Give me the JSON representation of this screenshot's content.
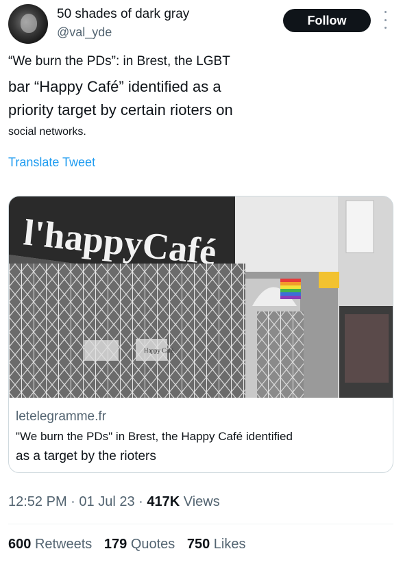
{
  "author": {
    "display_name": "50 shades of dark gray",
    "handle": "@val_yde",
    "avatar_icon": "profile-avatar"
  },
  "follow_label": "Follow",
  "more_icon": "more-options-icon",
  "tweet": {
    "lines": [
      "“We burn the PDs”: in Brest, the LGBT",
      "bar “Happy Café” identified as a",
      "priority target by certain rioters on",
      "social networks."
    ],
    "translate_label": "Translate Tweet"
  },
  "card": {
    "image_sign_text": "l'happyCafé",
    "image_door_sign": "Happy Café",
    "domain": "letelegramme.fr",
    "title_line_1": "\"We burn the PDs\" in Brest, the Happy Café identified",
    "title_line_2": "as a target by the rioters"
  },
  "meta": {
    "time": "12:52 PM",
    "sep1": " · ",
    "date": "01 Jul 23",
    "sep2": " · ",
    "views_count": "417K",
    "views_label": " Views"
  },
  "stats": {
    "retweets_count": "600",
    "retweets_label": "Retweets",
    "quotes_count": "179",
    "quotes_label": "Quotes",
    "likes_count": "750",
    "likes_label": "Likes"
  },
  "colors": {
    "accent": "#1d9bf0",
    "text": "#0f1419",
    "secondary": "#536471",
    "follow_bg": "#0f1419"
  }
}
